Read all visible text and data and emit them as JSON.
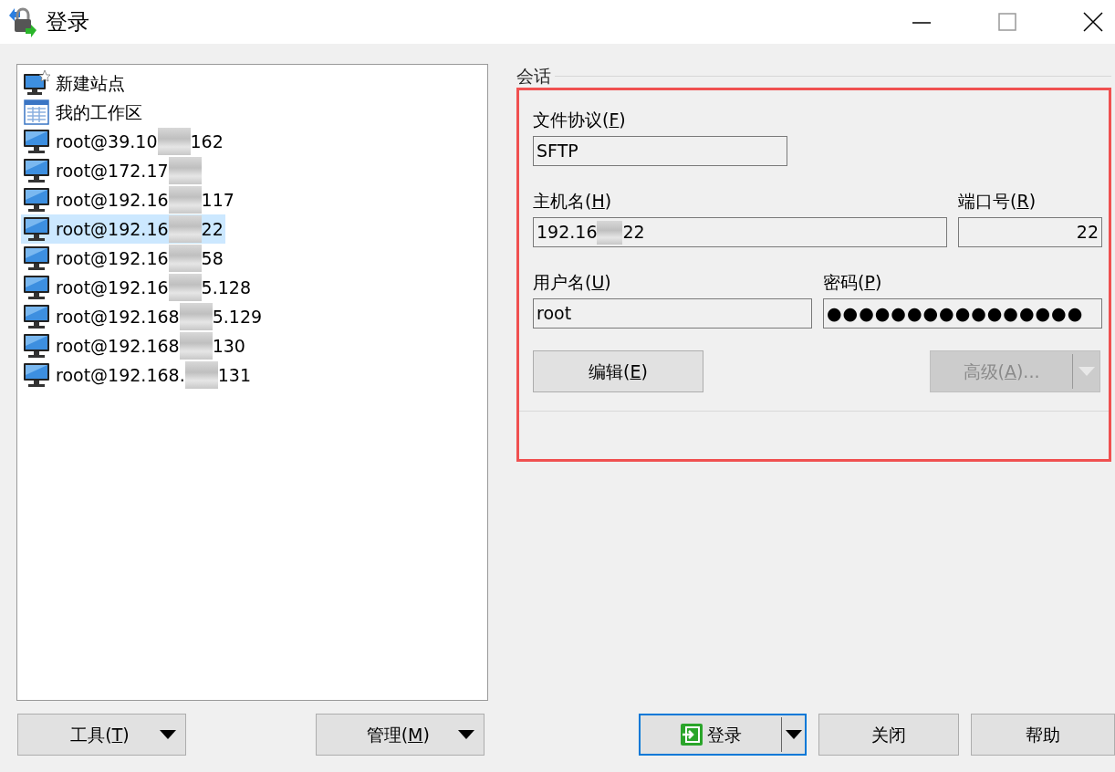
{
  "window": {
    "title": "登录"
  },
  "sites": [
    {
      "kind": "new",
      "text_start": "新建站点",
      "selected": false
    },
    {
      "kind": "workspace",
      "text_start": "我的工作区",
      "selected": false
    },
    {
      "kind": "host",
      "text_start": "root@39.10",
      "text_end": "162",
      "selected": false
    },
    {
      "kind": "host",
      "text_start": "root@172.17",
      "selected": false
    },
    {
      "kind": "host",
      "text_start": "root@192.16",
      "text_end": "117",
      "selected": false
    },
    {
      "kind": "host",
      "text_start": "root@192.16",
      "text_end": "22",
      "selected": true
    },
    {
      "kind": "host",
      "text_start": "root@192.16",
      "text_end": "58",
      "selected": false
    },
    {
      "kind": "host",
      "text_start": "root@192.16",
      "text_end": "5.128",
      "selected": false
    },
    {
      "kind": "host",
      "text_start": "root@192.168",
      "text_end": "5.129",
      "selected": false
    },
    {
      "kind": "host",
      "text_start": "root@192.168",
      "text_end": "130",
      "selected": false
    },
    {
      "kind": "host",
      "text_start": "root@192.168.",
      "text_end": "131",
      "selected": false
    }
  ],
  "session": {
    "group_title": "会话",
    "protocol": {
      "label": [
        "文件协议(",
        "F",
        ")"
      ],
      "value": "SFTP"
    },
    "host": {
      "label": [
        "主机名(",
        "H",
        ")"
      ],
      "value_start": "192.16",
      "value_end": "22"
    },
    "port": {
      "label": [
        "端口号(",
        "R",
        ")"
      ],
      "value": "22"
    },
    "user": {
      "label": [
        "用户名(",
        "U",
        ")"
      ],
      "value": "root"
    },
    "password": {
      "label": [
        "密码(",
        "P",
        ")"
      ],
      "value": "●●●●●●●●●●●●●●●●"
    },
    "edit_button": {
      "label": [
        "编辑(",
        "E",
        ")"
      ],
      "disabled": false
    },
    "advanced_button": {
      "label": [
        "高级(",
        "A",
        ")..."
      ],
      "disabled": true
    }
  },
  "bottom_buttons": [
    {
      "kind": "dropdown",
      "label": [
        "工具(",
        "T",
        ")"
      ],
      "default": false
    },
    {
      "kind": "dropdown",
      "label": [
        "管理(",
        "M",
        ")"
      ],
      "default": false
    },
    {
      "kind": "split",
      "label": [
        "登录"
      ],
      "icon": true,
      "default": true
    },
    {
      "kind": "plain",
      "label": [
        "关闭"
      ],
      "default": false
    },
    {
      "kind": "plain",
      "label": [
        "帮助"
      ],
      "default": false
    }
  ]
}
